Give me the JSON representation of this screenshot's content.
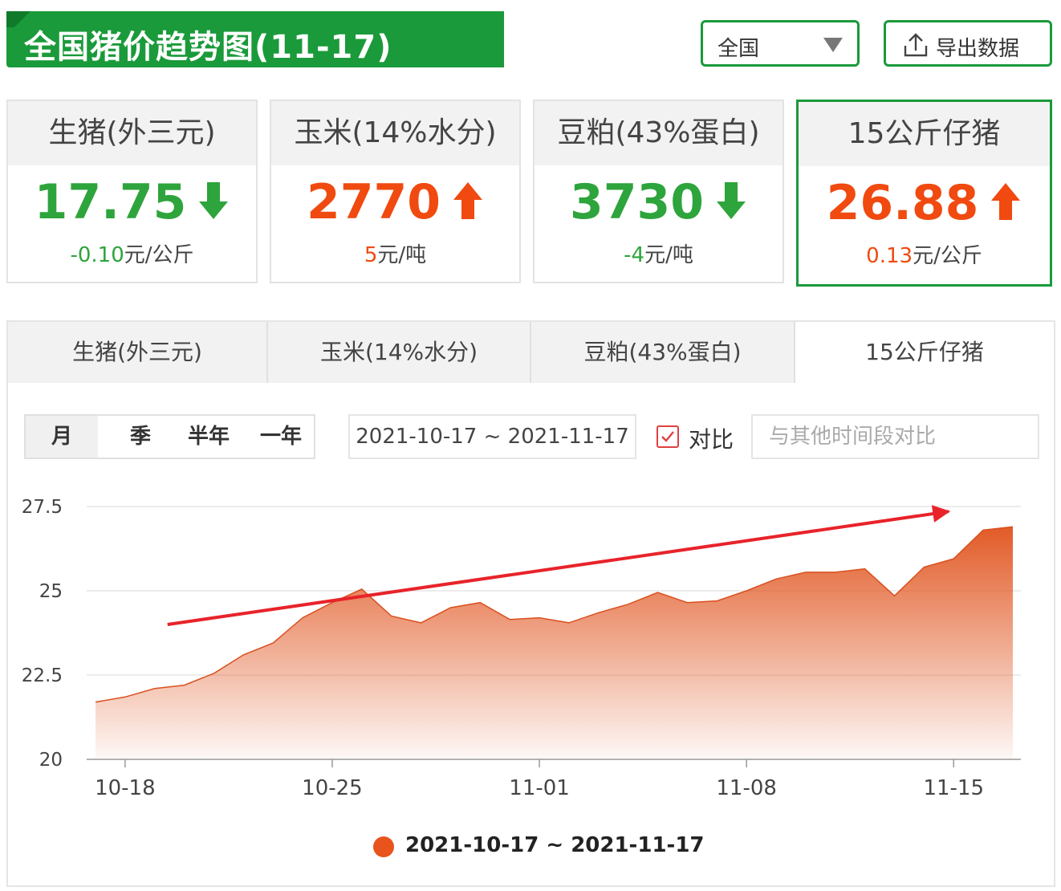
{
  "header": {
    "title": "全国猪价趋势图(11-17)",
    "region": "全国",
    "export_label": "导出数据"
  },
  "cards": [
    {
      "name": "生猪(外三元)",
      "price": "17.75",
      "direction": "down",
      "change": "-0.10",
      "unit": "元/公斤",
      "color": "#2ea43c"
    },
    {
      "name": "玉米(14%水分)",
      "price": "2770",
      "direction": "up",
      "change": "5",
      "unit": "元/吨",
      "color": "#f04a10"
    },
    {
      "name": "豆粕(43%蛋白)",
      "price": "3730",
      "direction": "down",
      "change": "-4",
      "unit": "元/吨",
      "color": "#2ea43c"
    },
    {
      "name": "15公斤仔猪",
      "price": "26.88",
      "direction": "up",
      "change": "0.13",
      "unit": "元/公斤",
      "color": "#f04a10"
    }
  ],
  "tabs": [
    "生猪(外三元)",
    "玉米(14%水分)",
    "豆粕(43%蛋白)",
    "15公斤仔猪"
  ],
  "controls": {
    "periods": [
      "月",
      "季",
      "半年",
      "一年"
    ],
    "date_range": "2021-10-17 ~ 2021-11-17",
    "compare_label": "对比",
    "compare_placeholder": "与其他时间段对比"
  },
  "chart_data": {
    "type": "area",
    "x": [
      "10-17",
      "10-18",
      "10-19",
      "10-20",
      "10-21",
      "10-22",
      "10-23",
      "10-24",
      "10-25",
      "10-26",
      "10-27",
      "10-28",
      "10-29",
      "10-30",
      "10-31",
      "11-01",
      "11-02",
      "11-03",
      "11-04",
      "11-05",
      "11-06",
      "11-07",
      "11-08",
      "11-09",
      "11-10",
      "11-11",
      "11-12",
      "11-13",
      "11-14",
      "11-15",
      "11-16",
      "11-17"
    ],
    "series": [
      {
        "name": "2021-10-17 ~ 2021-11-17",
        "values": [
          21.7,
          21.85,
          22.1,
          22.2,
          22.55,
          23.1,
          23.45,
          24.2,
          24.65,
          25.05,
          24.25,
          24.05,
          24.5,
          24.65,
          24.15,
          24.2,
          24.05,
          24.35,
          24.6,
          24.95,
          24.65,
          24.7,
          25.0,
          25.35,
          25.55,
          25.55,
          25.65,
          24.85,
          25.7,
          25.95,
          26.8,
          26.9
        ],
        "color": "#e8541c"
      }
    ],
    "x_ticks": [
      "10-18",
      "10-25",
      "11-01",
      "11-08",
      "11-15"
    ],
    "y_ticks": [
      "20",
      "22.5",
      "25",
      "27.5"
    ],
    "ylim": [
      20,
      27.5
    ],
    "grid": true,
    "legend_position": "bottom-center",
    "annotation": {
      "type": "trend-arrow",
      "from": [
        "10-19",
        24.0
      ],
      "to": [
        "11-17",
        27.4
      ],
      "color": "#e8232a"
    }
  }
}
